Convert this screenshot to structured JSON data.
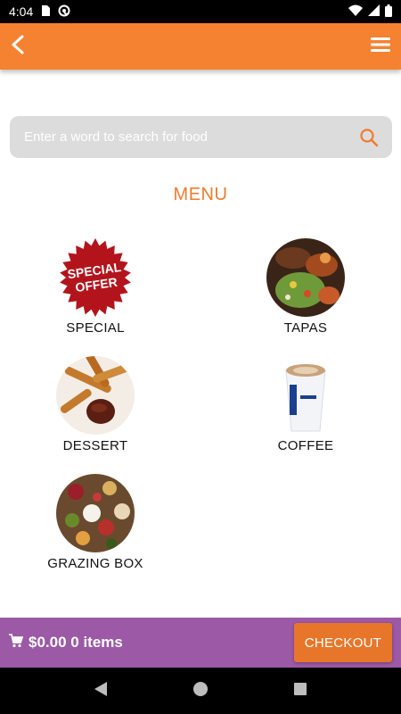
{
  "status_bar": {
    "time": "4:04",
    "icons": [
      "sim-card-icon",
      "at-sign-icon",
      "wifi-icon",
      "signal-icon",
      "battery-icon"
    ]
  },
  "app_bar": {
    "back_icon": "chevron-left-icon",
    "menu_icon": "hamburger-menu-icon",
    "color": "#f48231"
  },
  "search": {
    "placeholder": "Enter a word to search for food",
    "icon": "search-icon"
  },
  "menu": {
    "title": "MENU",
    "categories": [
      {
        "label": "SPECIAL",
        "image": "special-offer-badge",
        "badge_text_1": "SPECIAL",
        "badge_text_2": "OFFER"
      },
      {
        "label": "TAPAS",
        "image": "tapas-photo"
      },
      {
        "label": "DESSERT",
        "image": "churros-photo"
      },
      {
        "label": "COFFEE",
        "image": "coffee-cup-photo"
      },
      {
        "label": "GRAZING BOX",
        "image": "grazing-box-photo"
      }
    ]
  },
  "cart": {
    "total": "$0.00 0 items",
    "checkout_label": "CHECKOUT",
    "bar_color": "#9b59a6",
    "button_color": "#e8762a"
  },
  "nav_bar": {
    "icons": [
      "back-triangle-icon",
      "home-circle-icon",
      "recents-square-icon"
    ]
  }
}
